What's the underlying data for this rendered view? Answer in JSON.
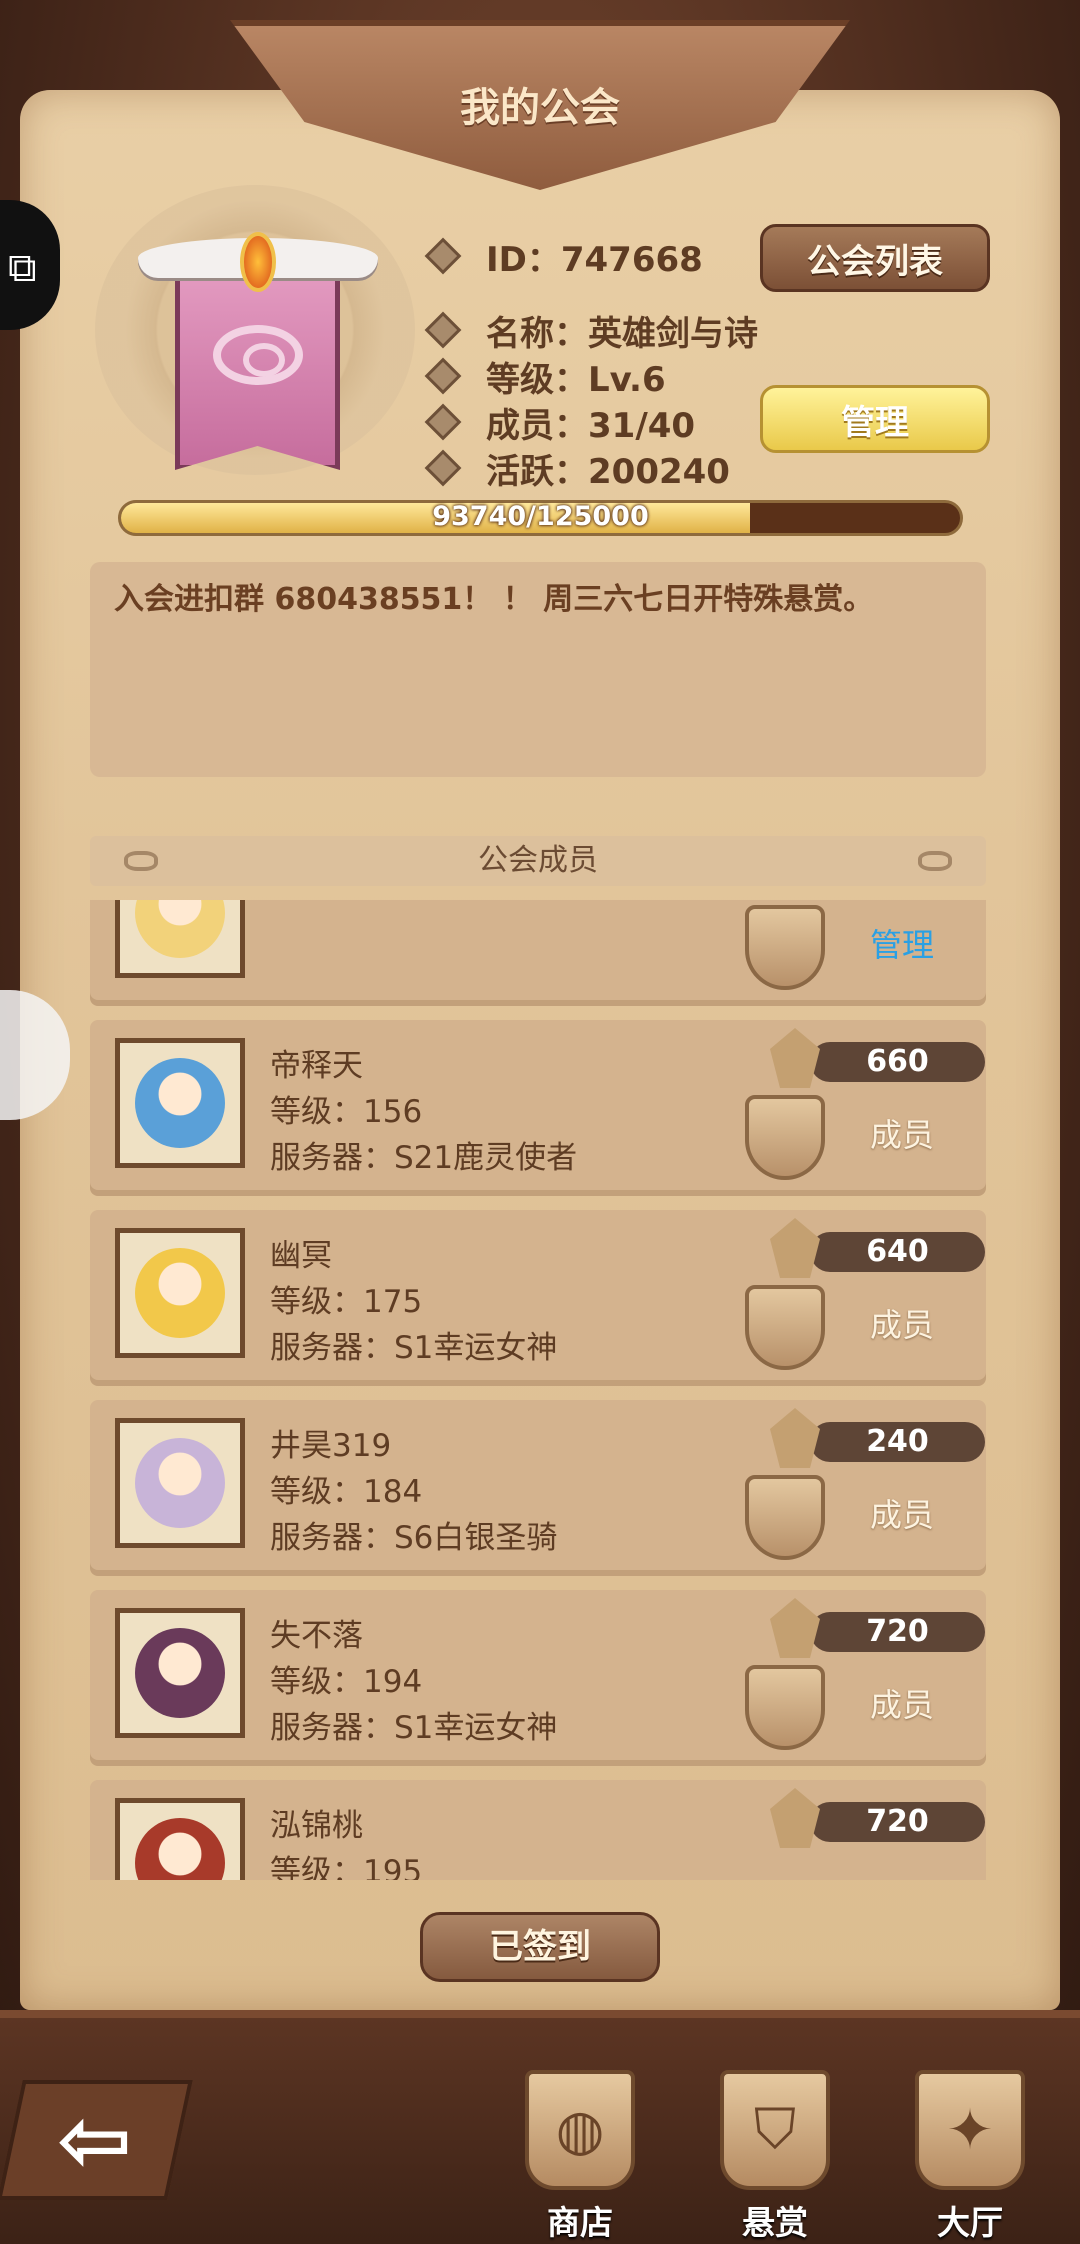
{
  "header": {
    "title": "我的公会"
  },
  "guild": {
    "id_label": "ID：747668",
    "name_label": "名称：英雄剑与诗",
    "level_label": "等级：Lv.6",
    "members_label": "成员：31/40",
    "activity_label": "活跃：200240",
    "progress_text": "93740/125000",
    "progress_fraction": 0.75,
    "notice": "入会进扣群 680438551！ ！ 周三六七日开特殊悬赏。"
  },
  "buttons": {
    "guild_list": "公会列表",
    "manage": "管理",
    "checkin": "已签到"
  },
  "members_section": {
    "title": "公会成员"
  },
  "members": [
    {
      "name": "",
      "level": "",
      "server": "",
      "score": "",
      "role": "管理",
      "face_color": "#f2d27a"
    },
    {
      "name": "帝释天",
      "level": "等级：156",
      "server": "服务器：S21鹿灵使者",
      "score": "660",
      "role": "成员",
      "face_color": "#5aa0d8"
    },
    {
      "name": "幽冥",
      "level": "等级：175",
      "server": "服务器：S1幸运女神",
      "score": "640",
      "role": "成员",
      "face_color": "#f2c84a"
    },
    {
      "name": "井昊319",
      "level": "等级：184",
      "server": "服务器：S6白银圣骑",
      "score": "240",
      "role": "成员",
      "face_color": "#c8b4d8"
    },
    {
      "name": "失不落",
      "level": "等级：194",
      "server": "服务器：S1幸运女神",
      "score": "720",
      "role": "成员",
      "face_color": "#6a3a5a"
    },
    {
      "name": "泓锦桃",
      "level": "等级：195",
      "server": "",
      "score": "720",
      "role": "",
      "face_color": "#a83a2a"
    }
  ],
  "nav": [
    {
      "label": "商店",
      "icon": "shop-icon"
    },
    {
      "label": "悬赏",
      "icon": "bounty-icon"
    },
    {
      "label": "大厅",
      "icon": "hall-icon"
    }
  ]
}
